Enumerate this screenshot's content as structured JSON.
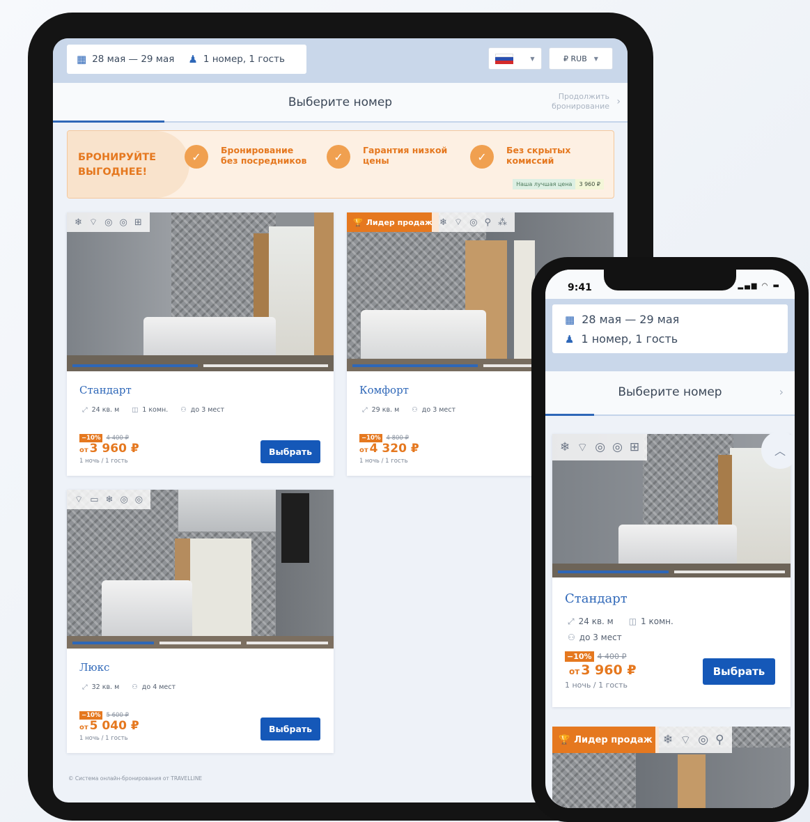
{
  "tablet": {
    "search": {
      "dates": "28 мая — 29 мая",
      "guests": "1 номер, 1 гость"
    },
    "language_flag": "ru-flag-icon",
    "currency": "₽ RUB",
    "header": {
      "title": "Выберите номер",
      "continue": "Продолжить бронирование"
    },
    "promo": {
      "headline_line1": "БРОНИРУЙТЕ",
      "headline_line2": "ВЫГОДНЕЕ!",
      "benefits": [
        {
          "line1": "Бронирование",
          "line2": "без посредников"
        },
        {
          "line1": "Гарантия низкой",
          "line2": "цены"
        },
        {
          "line1": "Без скрытых",
          "line2": "комиссий"
        }
      ],
      "best_price_label": "Наша лучшая цена",
      "best_price_value": "3 960 ₽"
    },
    "rooms": [
      {
        "name": "Стандарт",
        "area": "24 кв. м",
        "rooms_count": "1 комн.",
        "capacity": "до 3 мест",
        "discount": "−10%",
        "old_price": "4 400 ₽",
        "price_prefix": "от",
        "price": "3 960 ₽",
        "per": "1 ночь / 1 гость",
        "button": "Выбрать",
        "amenities": [
          "snowflake-icon",
          "wifi-icon",
          "check-icon",
          "check-icon",
          "book-icon"
        ]
      },
      {
        "name": "Комфорт",
        "badge": "Лидер продаж",
        "area": "29 кв. м",
        "capacity": "до 3 мест",
        "discount": "−10%",
        "old_price": "4 800 ₽",
        "price_prefix": "от",
        "price": "4 320 ₽",
        "per": "1 ночь / 1 гость",
        "amenities": [
          "snowflake-icon",
          "wifi-icon",
          "check-icon",
          "robe-icon",
          "slippers-icon"
        ]
      },
      {
        "name": "Люкс",
        "area": "32 кв. м",
        "capacity": "до 4 мест",
        "discount": "−10%",
        "old_price": "5 600 ₽",
        "price_prefix": "от",
        "price": "5 040 ₽",
        "per": "1 ночь / 1 гость",
        "button": "Выбрать",
        "amenities": [
          "wifi-icon",
          "tv-icon",
          "snowflake-icon",
          "check-icon",
          "check-icon"
        ]
      }
    ],
    "footer": "© Система онлайн-бронирования от TRAVELLINE"
  },
  "phone": {
    "time": "9:41",
    "dates": "28 мая — 29 мая",
    "guests": "1 номер, 1 гость",
    "header_title": "Выберите номер",
    "room": {
      "name": "Стандарт",
      "area": "24 кв. м",
      "rooms_count": "1 комн.",
      "capacity": "до 3 мест",
      "discount": "−10%",
      "old_price": "4 400 ₽",
      "price_prefix": "от",
      "price": "3 960 ₽",
      "per": "1 ночь / 1 гость",
      "button": "Выбрать"
    },
    "next_badge": "Лидер продаж"
  },
  "colors": {
    "accent": "#2e67b8",
    "orange": "#e5781f",
    "button": "#1558b8"
  }
}
